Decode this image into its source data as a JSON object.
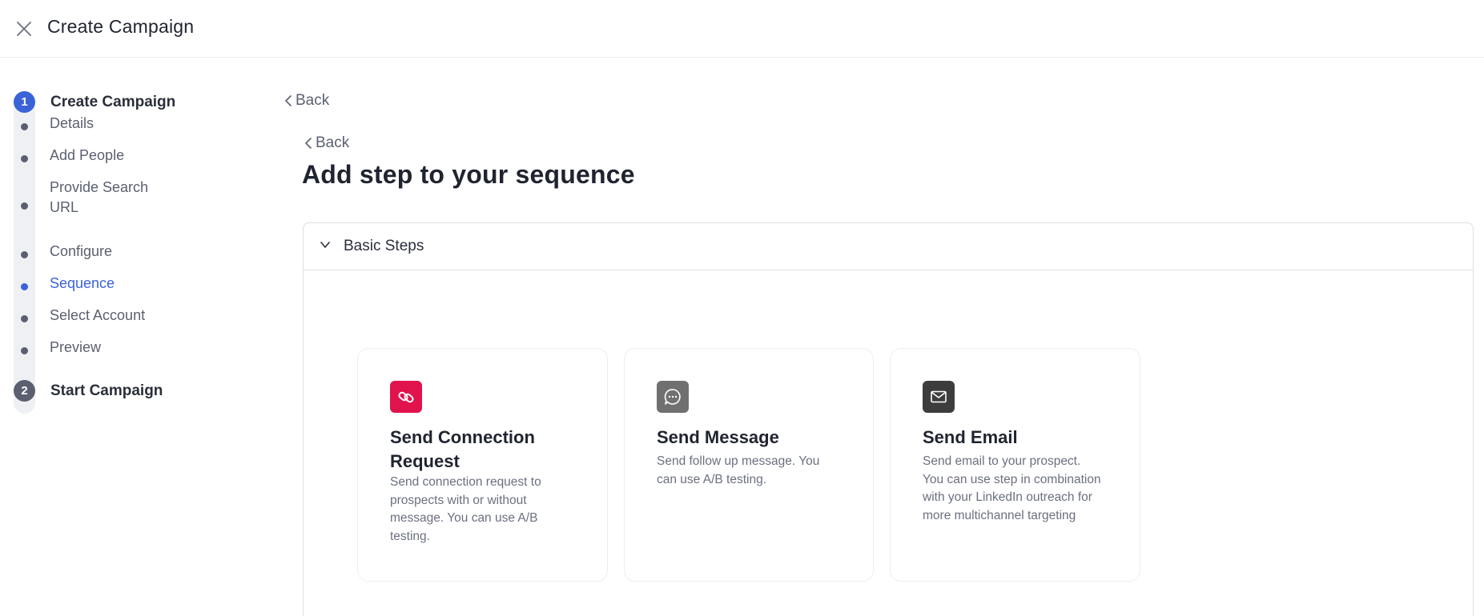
{
  "header": {
    "title": "Create Campaign"
  },
  "stepper": {
    "major": [
      {
        "number": "1",
        "label": "Create Campaign",
        "color": "#3a63d8"
      },
      {
        "number": "2",
        "label": "Start Campaign",
        "color": "#5b6070"
      }
    ],
    "minor": [
      {
        "label": "Details"
      },
      {
        "label": "Add People"
      },
      {
        "label": "Provide Search URL"
      },
      {
        "label": "Configure"
      },
      {
        "label": "Sequence",
        "active": true
      },
      {
        "label": "Select Account"
      },
      {
        "label": "Preview"
      }
    ]
  },
  "main": {
    "back_outer": "Back",
    "back_inner": "Back",
    "title": "Add step to your sequence",
    "section": {
      "title": "Basic Steps",
      "expanded": true
    },
    "cards": [
      {
        "icon": "link-icon",
        "icon_bg": "#e0134c",
        "title": "Send Connection Request",
        "description": "Send connection request to prospects with or without message. You can use A/B testing."
      },
      {
        "icon": "chat-bubble-icon",
        "icon_bg": "#707070",
        "title": "Send Message",
        "description": "Send follow up message. You can use A/B testing."
      },
      {
        "icon": "envelope-icon",
        "icon_bg": "#3d3d3d",
        "title": "Send Email",
        "description": "Send email to your prospect. You can use step in combination with your LinkedIn outreach for more multichannel targeting"
      }
    ]
  }
}
